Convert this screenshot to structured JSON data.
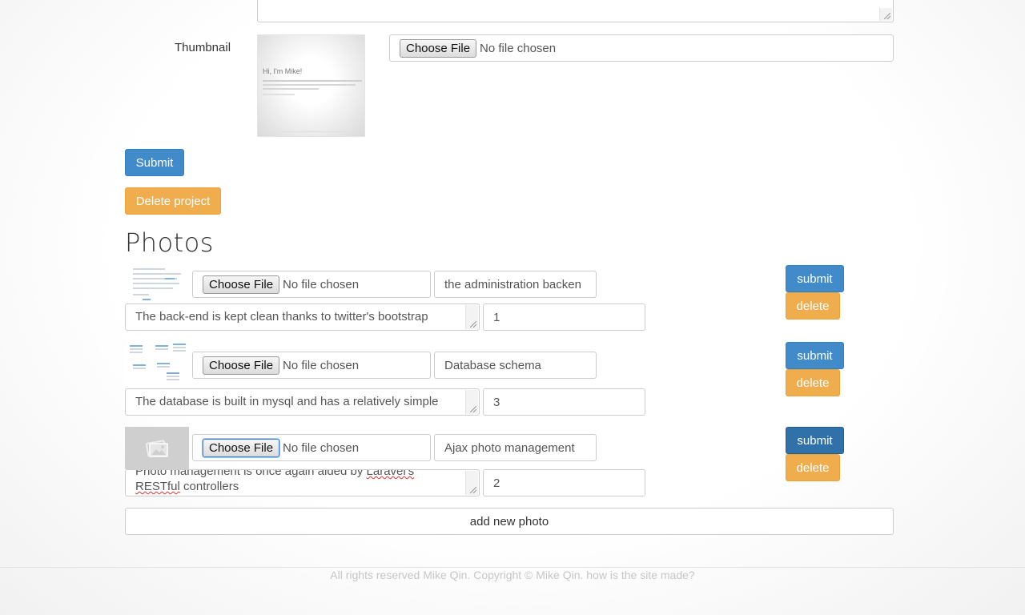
{
  "project_form": {
    "thumbnail_label": "Thumbnail",
    "thumbnail_preview": {
      "heading": "Hi, I'm Mike!"
    },
    "file_input": {
      "button_label": "Choose File",
      "status": "No file chosen"
    },
    "submit_label": "Submit",
    "delete_label": "Delete project"
  },
  "photos": {
    "title": "Photos",
    "items": [
      {
        "choose_label": "Choose File",
        "file_status": "No file chosen",
        "title": "the administration backen",
        "description": "The back-end is kept clean thanks to twitter's bootstrap",
        "order": "1",
        "submit_label": "submit",
        "delete_label": "delete"
      },
      {
        "choose_label": "Choose File",
        "file_status": "No file chosen",
        "title": "Database schema",
        "description": "The database is built in mysql and has a relatively simple",
        "order": "3",
        "submit_label": "submit",
        "delete_label": "delete"
      },
      {
        "choose_label": "Choose File",
        "file_status": "No file chosen",
        "title": "Ajax photo management",
        "description_line1": "Photo management is once again aided by ",
        "description_word": "Laravel's",
        "description_line2_word": "RESTful",
        "description_line2_rest": " controllers",
        "order": "2",
        "submit_label": "submit",
        "delete_label": "delete"
      }
    ],
    "add_label": "add new photo"
  },
  "footer": {
    "text": "All rights reserved Mike Qin. Copyright © Mike Qin. how is the site made?"
  },
  "colors": {
    "primary": "#428bca",
    "warning": "#f0ad4e",
    "footer_text": "#c6c6c6"
  },
  "icons": {
    "placeholder_image": "image-placeholder-icon",
    "resize_grip": "resize-grip-icon"
  }
}
